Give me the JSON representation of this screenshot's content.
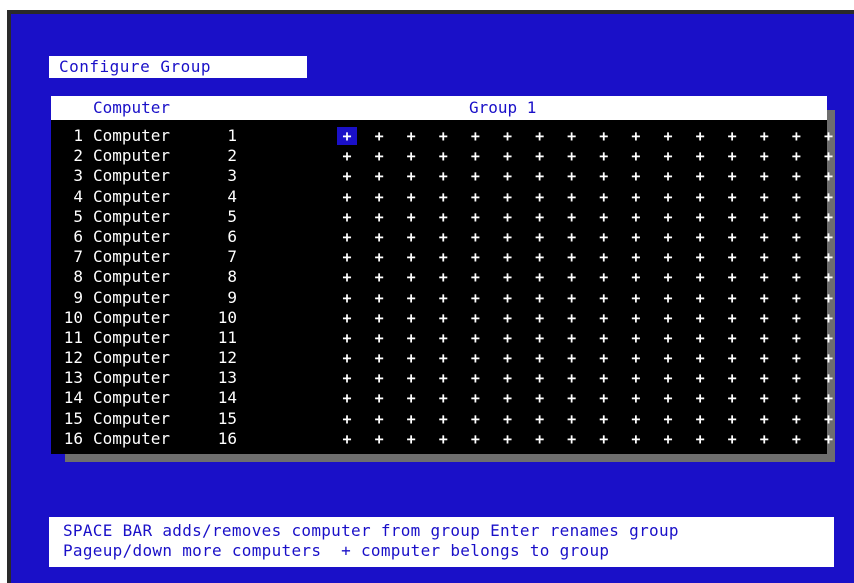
{
  "title": "Configure Group",
  "table": {
    "header_computer": "Computer",
    "header_group": "Group 1",
    "mark": "+",
    "rows": [
      {
        "num": "1",
        "name": "Computer",
        "idx": "1"
      },
      {
        "num": "2",
        "name": "Computer",
        "idx": "2"
      },
      {
        "num": "3",
        "name": "Computer",
        "idx": "3"
      },
      {
        "num": "4",
        "name": "Computer",
        "idx": "4"
      },
      {
        "num": "5",
        "name": "Computer",
        "idx": "5"
      },
      {
        "num": "6",
        "name": "Computer",
        "idx": "6"
      },
      {
        "num": "7",
        "name": "Computer",
        "idx": "7"
      },
      {
        "num": "8",
        "name": "Computer",
        "idx": "8"
      },
      {
        "num": "9",
        "name": "Computer",
        "idx": "9"
      },
      {
        "num": "10",
        "name": "Computer",
        "idx": "10"
      },
      {
        "num": "11",
        "name": "Computer",
        "idx": "11"
      },
      {
        "num": "12",
        "name": "Computer",
        "idx": "12"
      },
      {
        "num": "13",
        "name": "Computer",
        "idx": "13"
      },
      {
        "num": "14",
        "name": "Computer",
        "idx": "14"
      },
      {
        "num": "15",
        "name": "Computer",
        "idx": "15"
      },
      {
        "num": "16",
        "name": "Computer",
        "idx": "16"
      }
    ],
    "columns_count": 16,
    "selected_cell": {
      "row": 1,
      "col": 1
    }
  },
  "help": {
    "line1": "SPACE BAR adds/removes computer from group Enter renames group",
    "line2": "Pageup/down more computers  + computer belongs to group"
  },
  "colors": {
    "background": "#1a10c8",
    "panel": "#000000",
    "text_on_white": "#1a10c8",
    "text_on_black": "#ffffff"
  }
}
